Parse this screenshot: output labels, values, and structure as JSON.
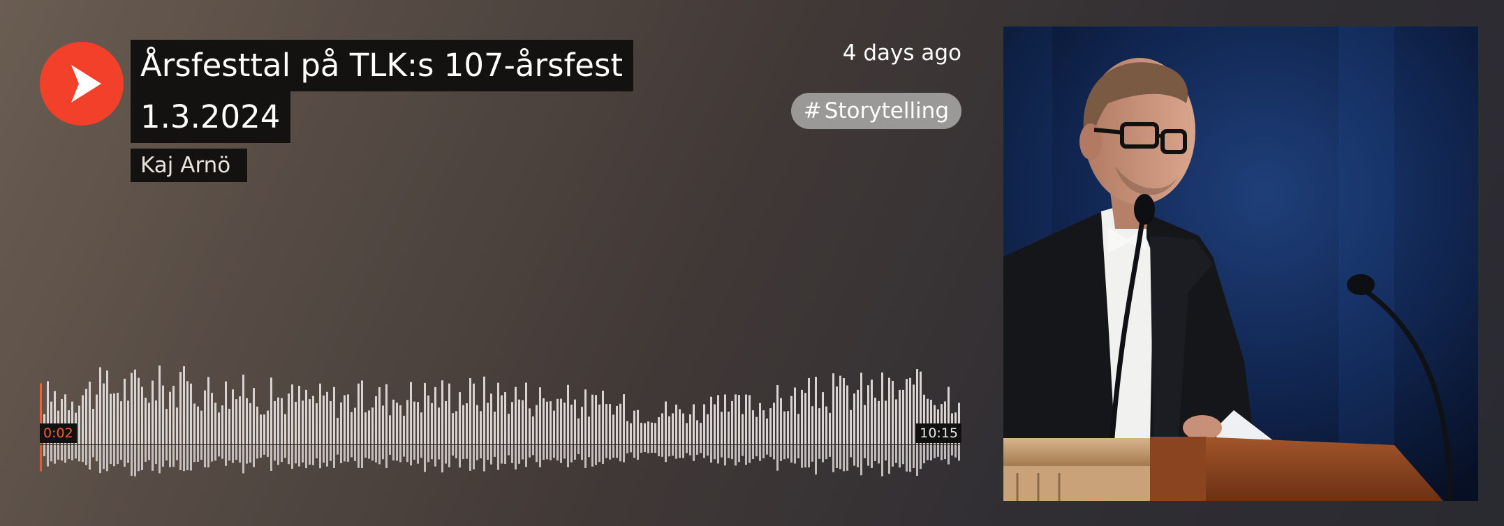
{
  "track": {
    "title_line1": "Årsfesttal på TLK:s 107-årsfest",
    "title_line2": "1.3.2024",
    "artist": "Kaj Arnö",
    "posted": "4 days ago",
    "tag_symbol": "#",
    "tag": "Storytelling"
  },
  "playback": {
    "current_time": "0:02",
    "total_time": "10:15",
    "progress": 0.003
  },
  "colors": {
    "accent": "#f2402a",
    "progress": "#ff5a33",
    "wave": "#d9d4d2",
    "badge_bg": "#141210",
    "tag_bg": "#9b9898"
  },
  "icons": {
    "play": "play-icon"
  }
}
